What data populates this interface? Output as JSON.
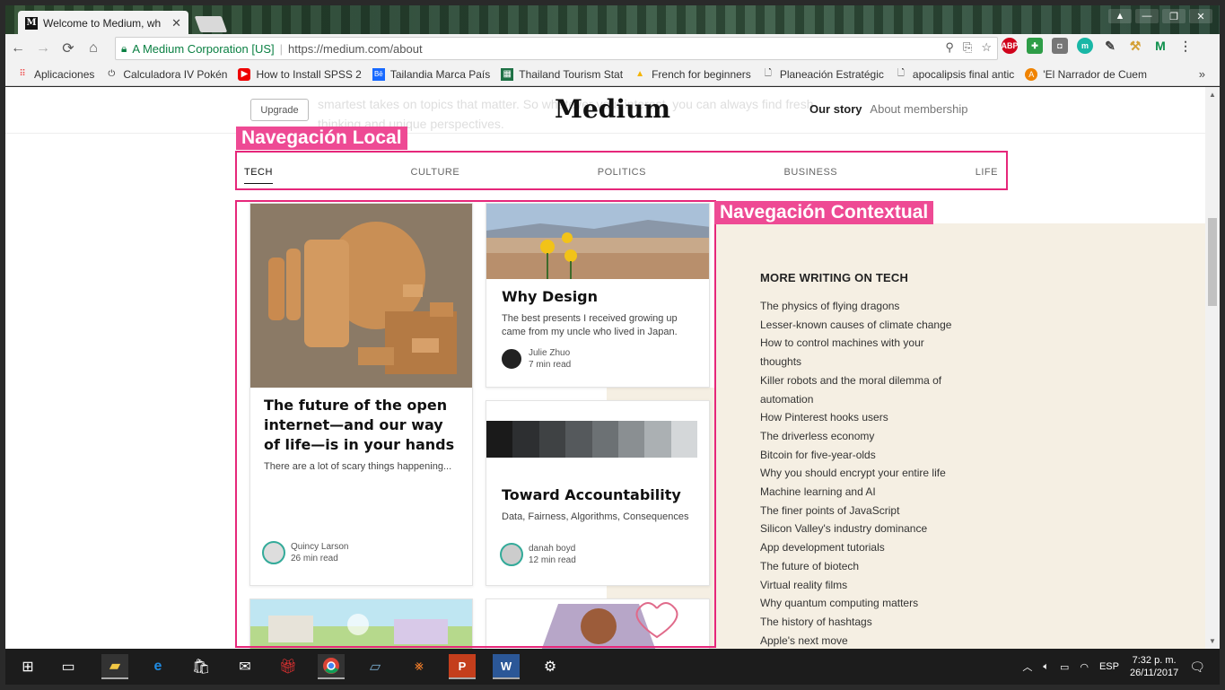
{
  "browser": {
    "tab_title": "Welcome to Medium, wh",
    "tab_favicon": "M",
    "tab_close": "✕",
    "secure_label": "A Medium Corporation [US]",
    "url": "https://medium.com/about",
    "window_controls": [
      "▲",
      "—",
      "❐",
      "✕"
    ]
  },
  "bookmarks": [
    {
      "label": "Aplicaciones",
      "icon": "apps-grid-icon"
    },
    {
      "label": "Calculadora IV Pokén",
      "icon": "power-icon"
    },
    {
      "label": "How to Install SPSS 2",
      "icon": "youtube-icon"
    },
    {
      "label": "Tailandia Marca País",
      "icon": "behance-icon"
    },
    {
      "label": "Thailand Tourism Stat",
      "icon": "sheet-icon"
    },
    {
      "label": "French for beginners",
      "icon": "drive-icon"
    },
    {
      "label": "Planeación Estratégic",
      "icon": "doc-icon"
    },
    {
      "label": "apocalipsis final antic",
      "icon": "doc-icon"
    },
    {
      "label": "'El Narrador de Cuem",
      "icon": "avast-icon"
    }
  ],
  "bookmarks_more": "»",
  "medium": {
    "upgrade": "Upgrade",
    "logo": "Medium",
    "nav_our_story": "Our story",
    "nav_about_membership": "About membership",
    "ghost_text": "smartest takes on topics that matter. So whatever your interest, you can always find fresh thinking and unique perspectives."
  },
  "annotations": {
    "local": "Navegación Local",
    "contextual": "Navegación Contextual"
  },
  "topics": [
    "TECH",
    "CULTURE",
    "POLITICS",
    "BUSINESS",
    "LIFE"
  ],
  "cards": {
    "big": {
      "title": "The future of the open internet—and our way of life—is in your hands",
      "subtitle": "There are a lot of scary things happening...",
      "author": "Quincy Larson",
      "read": "26 min read"
    },
    "design": {
      "title": "Why Design",
      "subtitle": "The best presents I received growing up came from my uncle who lived in Japan.",
      "author": "Julie Zhuo",
      "read": "7 min read"
    },
    "accountability": {
      "title": "Toward Accountability",
      "subtitle": "Data, Fairness, Algorithms, Consequences",
      "author": "danah boyd",
      "read": "12 min read"
    }
  },
  "sidebar": {
    "title": "MORE WRITING ON TECH",
    "items": [
      "The physics of flying dragons",
      "Lesser-known causes of climate change",
      "How to control machines with your thoughts",
      "Killer robots and the moral dilemma of automation",
      "How Pinterest hooks users",
      "The driverless economy",
      "Bitcoin for five-year-olds",
      "Why you should encrypt your entire life",
      "Machine learning and AI",
      "The finer points of JavaScript",
      "Silicon Valley's industry dominance",
      "App development tutorials",
      "The future of biotech",
      "Virtual reality films",
      "Why quantum computing matters",
      "The history of hashtags",
      "Apple's next move"
    ]
  },
  "tray": {
    "lang": "ESP",
    "time": "7:32 p. m.",
    "date": "26/11/2017"
  }
}
